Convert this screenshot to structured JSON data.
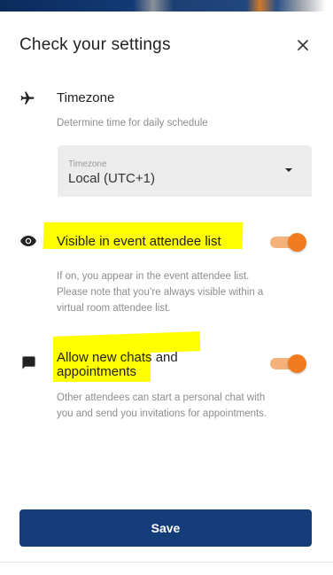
{
  "dialog": {
    "title": "Check your settings",
    "close_icon": "close-icon"
  },
  "timezone": {
    "icon": "airplane-icon",
    "label": "Timezone",
    "description": "Determine time for daily schedule",
    "select": {
      "floating_label": "Timezone",
      "value": "Local (UTC+1)",
      "caret_icon": "dropdown-caret-icon"
    }
  },
  "visibility": {
    "icon": "eye-icon",
    "label": "Visible in event attendee list",
    "description_lines": [
      "If on, you appear in the event attendee list.",
      "Please note that you’re always visible within a",
      "virtual room attendee list."
    ],
    "toggle_on": true
  },
  "chats": {
    "icon": "chat-icon",
    "label_lines": [
      "Allow new chats and",
      "appointments"
    ],
    "description_lines": [
      "Other attendees can start a personal chat with",
      "you and send you invitations for appointments."
    ],
    "toggle_on": true
  },
  "footer": {
    "save_label": "Save"
  },
  "colors": {
    "primary": "#143d7a",
    "toggle_thumb": "#f07c1f",
    "toggle_track": "#f4b27a",
    "highlight": "#ffff00",
    "select_bg": "#ececec"
  }
}
